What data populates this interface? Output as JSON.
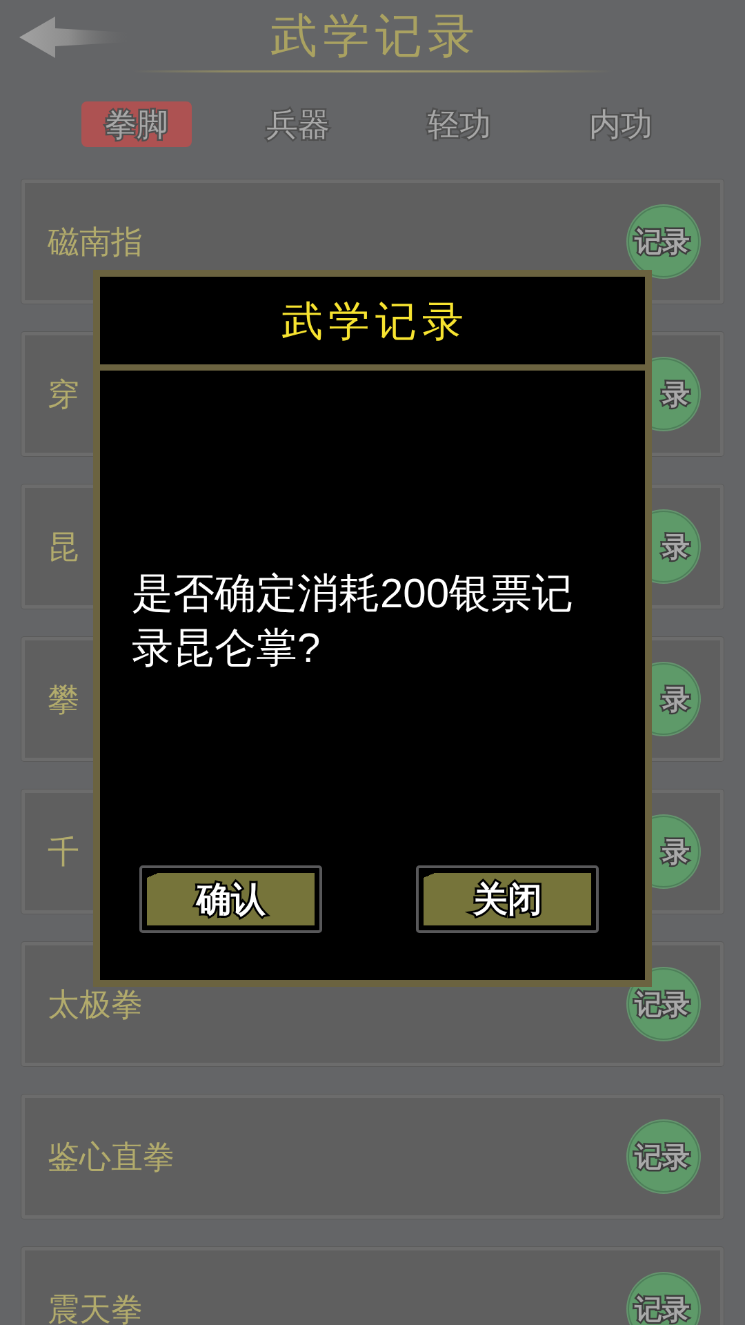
{
  "header": {
    "title": "武学记录"
  },
  "tabs": [
    {
      "label": "拳脚",
      "selected": true
    },
    {
      "label": "兵器",
      "selected": false
    },
    {
      "label": "轻功",
      "selected": false
    },
    {
      "label": "内功",
      "selected": false
    }
  ],
  "skills": [
    {
      "name": "磁南指",
      "record": "记录"
    },
    {
      "name": "穿",
      "record": "录"
    },
    {
      "name": "昆",
      "record": "录"
    },
    {
      "name": "攀",
      "record": "录"
    },
    {
      "name": "千",
      "record": "录"
    },
    {
      "name": "太极拳",
      "record": "记录"
    },
    {
      "name": "鉴心直拳",
      "record": "记录"
    },
    {
      "name": "震天拳",
      "record": "记录"
    }
  ],
  "dialog": {
    "title": "武学记录",
    "message": "是否确定消耗200银票记录昆仑掌?",
    "buttons": [
      "确认",
      "关闭"
    ]
  }
}
